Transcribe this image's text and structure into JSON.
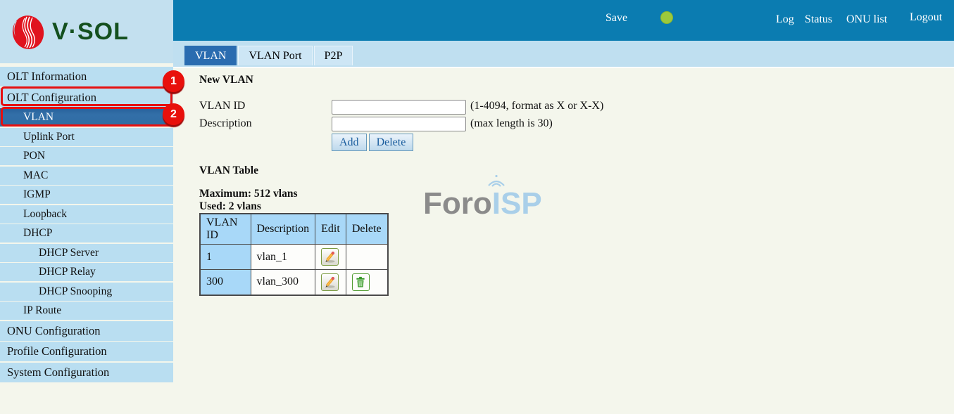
{
  "brand": {
    "logo_text": "V·SOL"
  },
  "topbar": {
    "save_label": "Save",
    "links": [
      "Log",
      "Status",
      "ONU list",
      "Logout"
    ]
  },
  "tabs": [
    {
      "label": "VLAN",
      "active": true
    },
    {
      "label": "VLAN Port",
      "active": false
    },
    {
      "label": "P2P",
      "active": false
    }
  ],
  "sidebar": {
    "items": [
      {
        "label": "OLT Information",
        "level": 1
      },
      {
        "label": "OLT Configuration",
        "level": 1
      },
      {
        "label": "VLAN",
        "level": 2,
        "active": true
      },
      {
        "label": "Uplink Port",
        "level": 2
      },
      {
        "label": "PON",
        "level": 2
      },
      {
        "label": "MAC",
        "level": 2
      },
      {
        "label": "IGMP",
        "level": 2
      },
      {
        "label": "Loopback",
        "level": 2
      },
      {
        "label": "DHCP",
        "level": 2
      },
      {
        "label": "DHCP Server",
        "level": 3
      },
      {
        "label": "DHCP Relay",
        "level": 3
      },
      {
        "label": "DHCP Snooping",
        "level": 3
      },
      {
        "label": "IP Route",
        "level": 2
      },
      {
        "label": "ONU Configuration",
        "level": 1
      },
      {
        "label": "Profile Configuration",
        "level": 1
      },
      {
        "label": "System Configuration",
        "level": 1
      }
    ]
  },
  "annotations": {
    "step1": "1",
    "step2": "2",
    "color": "#e60f0f"
  },
  "form": {
    "title": "New VLAN",
    "vlan_id": {
      "label": "VLAN ID",
      "value": "",
      "hint": "(1-4094, format as X or X-X)"
    },
    "description": {
      "label": "Description",
      "value": "",
      "hint": "(max length is 30)"
    },
    "add_label": "Add",
    "delete_label": "Delete"
  },
  "table_section": {
    "title": "VLAN Table",
    "maximum": "Maximum: 512 vlans",
    "used": "Used: 2 vlans",
    "columns": [
      "VLAN ID",
      "Description",
      "Edit",
      "Delete"
    ],
    "rows": [
      {
        "vlan_id": "1",
        "description": "vlan_1",
        "can_delete": false
      },
      {
        "vlan_id": "300",
        "description": "vlan_300",
        "can_delete": true
      }
    ]
  },
  "watermark": {
    "part1": "Foro",
    "part2": "I",
    "part3": "SP"
  },
  "colors": {
    "topbar": "#0b7cb1",
    "selected_item": "#2e6da4",
    "tab_active": "#2a6cb0",
    "sidebar_item": "#b9def1",
    "table_header": "#a8d8f8",
    "status_dot": "#9dc93c",
    "logo_red": "#e0131e",
    "logo_green": "#14501e"
  }
}
